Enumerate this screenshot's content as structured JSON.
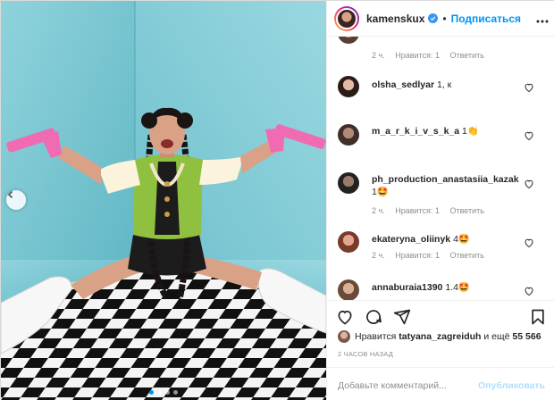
{
  "post": {
    "username": "kamenskux",
    "follow_label": "Подписаться",
    "separator": "•",
    "likes_prefix": "Нравится",
    "likes_user": "tatyana_zagreiduh",
    "likes_conj": "и ещё",
    "likes_count": "55 566",
    "time": "2 ЧАСОВ НАЗАД",
    "comment_placeholder": "Добавьте комментарий...",
    "publish_label": "Опубликовать"
  },
  "carousel": {
    "count": 4,
    "active": 1
  },
  "colors": {
    "accent": "#0095f6",
    "wall": "#7fc9d4",
    "pistol": "#f06bb2"
  },
  "icons": [
    "verified-badge-icon",
    "more-options-icon",
    "heart-icon",
    "comment-icon",
    "share-icon",
    "bookmark-icon",
    "chevron-left-icon"
  ],
  "comments": [
    {
      "username": "",
      "text": "",
      "time": "2 ч.",
      "likes": "Нравится: 1",
      "reply": "Ответить"
    },
    {
      "username": "olsha_sedlyar",
      "text": "1, к",
      "time": "",
      "likes": "",
      "reply": ""
    },
    {
      "username": "m_a_r_k_i_v_s_k_a",
      "text": "1👏",
      "time": "",
      "likes": "",
      "reply": ""
    },
    {
      "username": "ph_production_anastasiia_kazak",
      "text": "1🤩",
      "time": "2 ч.",
      "likes": "Нравится: 1",
      "reply": "Ответить"
    },
    {
      "username": "ekateryna_oliinyk",
      "text": "4🤩",
      "time": "2 ч.",
      "likes": "Нравится: 1",
      "reply": "Ответить"
    },
    {
      "username": "annaburaia1390",
      "text": "1.4🤩",
      "time": "",
      "likes": "",
      "reply": ""
    }
  ]
}
